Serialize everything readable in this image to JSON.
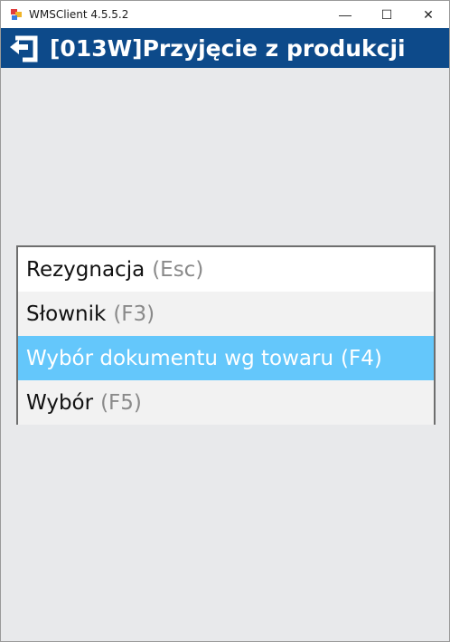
{
  "window": {
    "title": "WMSClient 4.5.5.2",
    "minimize_glyph": "—",
    "maximize_glyph": "☐",
    "close_glyph": "✕"
  },
  "header": {
    "title": "[013W]Przyjęcie z produkcji",
    "icon": "back-arrow-icon",
    "background": "#0d4a8a"
  },
  "menu": {
    "items": [
      {
        "label": "Rezygnacja",
        "key": "(Esc)"
      },
      {
        "label": "Słownik",
        "key": "(F3)"
      },
      {
        "label": "Wybór dokumentu wg towaru",
        "key": "(F4)",
        "selected": true
      },
      {
        "label": "Wybór",
        "key": "(F5)"
      }
    ],
    "selected_color": "#64c7fb"
  }
}
